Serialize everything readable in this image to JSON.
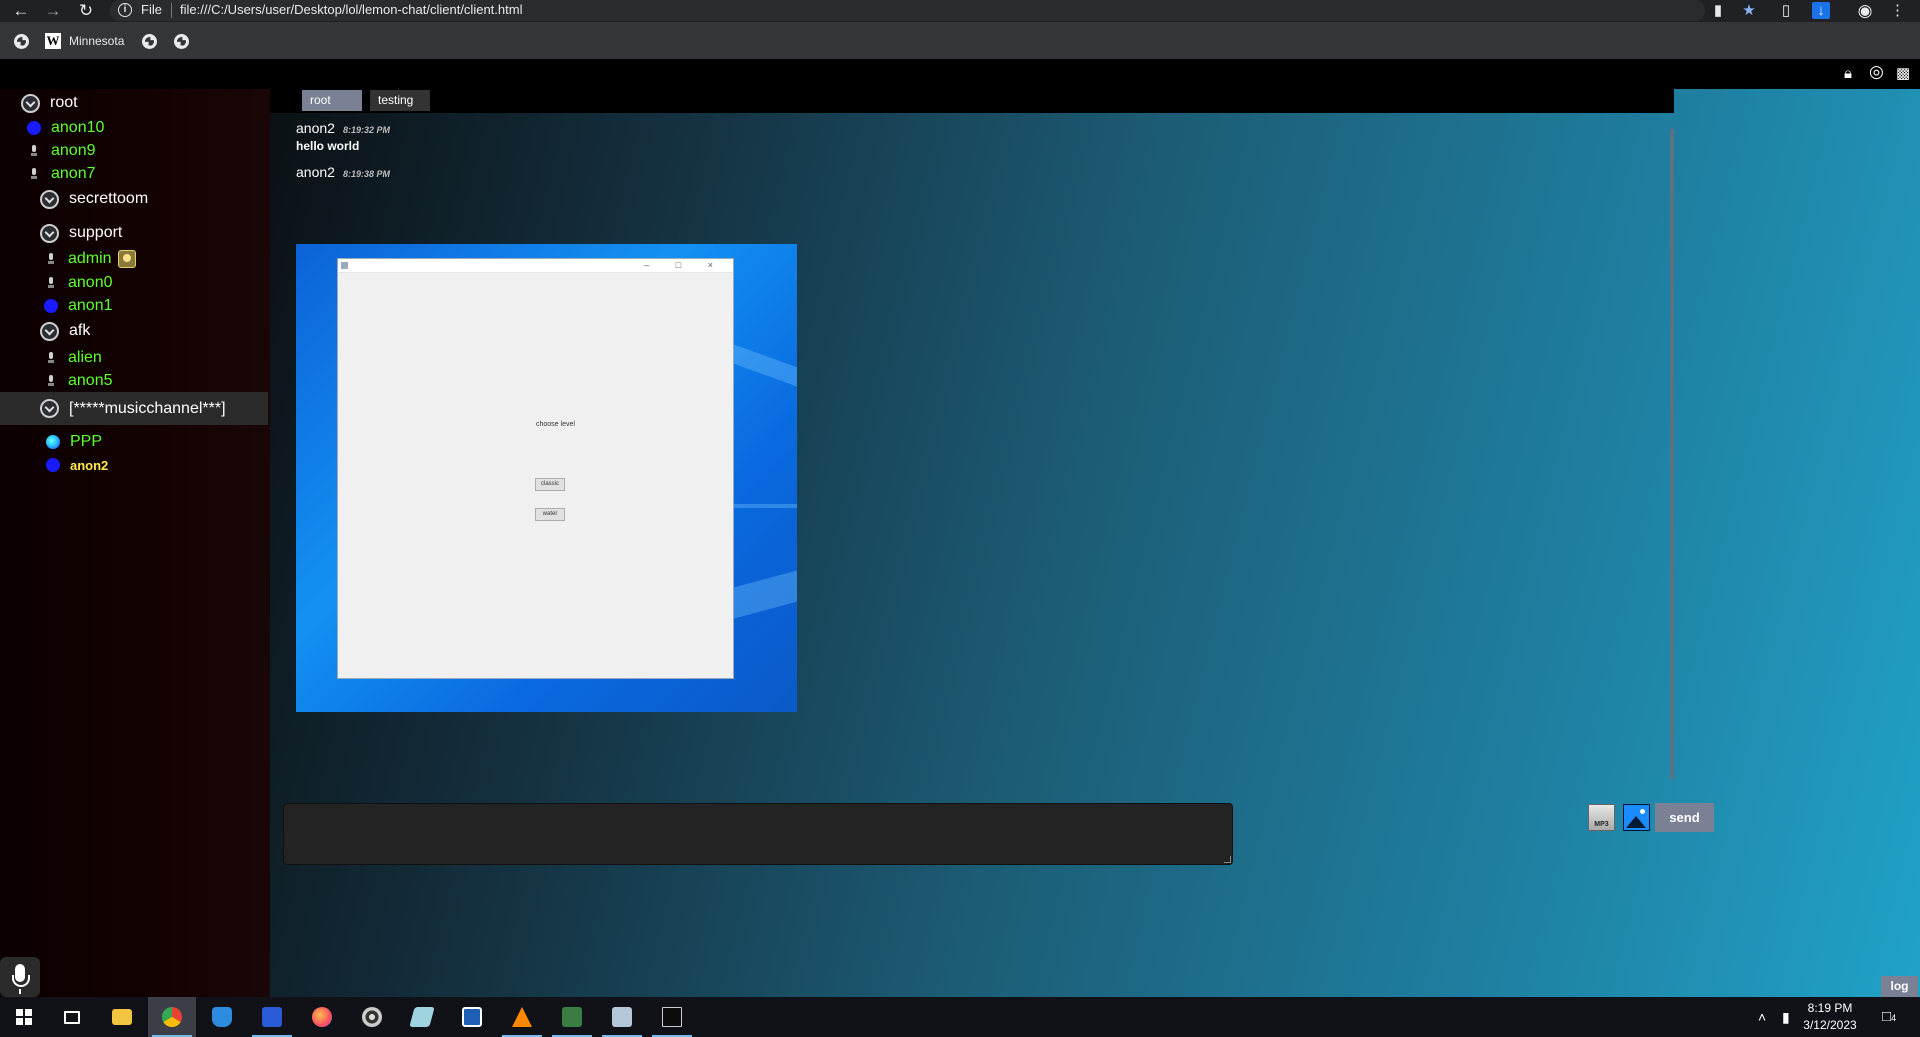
{
  "browser": {
    "scheme": "File",
    "url": "file:///C:/Users/user/Desktop/lol/lemon-chat/client/client.html",
    "bookmarks": [
      {
        "label": ""
      },
      {
        "label": "Minnesota",
        "badge": "W"
      },
      {
        "label": ""
      },
      {
        "label": ""
      }
    ]
  },
  "app": {
    "tabs": [
      {
        "label": "root",
        "active": true
      },
      {
        "label": "testing",
        "active": false
      }
    ],
    "tree": {
      "root": "root",
      "root_users": [
        "anon10",
        "anon9",
        "anon7"
      ],
      "channels": {
        "secrettoom": "secrettoom",
        "support": "support",
        "support_users": [
          "admin",
          "anon0",
          "anon1"
        ],
        "afk": "afk",
        "afk_users": [
          "alien",
          "anon5"
        ],
        "music": "[*****musicchannel***]",
        "music_users": [
          "PPP",
          "anon2"
        ]
      }
    },
    "messages": [
      {
        "author": "anon2",
        "time": "8:19:32 PM",
        "text": "hello world"
      },
      {
        "author": "anon2",
        "time": "8:19:38 PM",
        "image": {
          "label": "choose level",
          "buttons": [
            "classic",
            "water"
          ]
        }
      }
    ],
    "composer": {
      "value": "",
      "send_label": "send",
      "mp3_label": "MP3"
    },
    "log_label": "log"
  },
  "taskbar": {
    "time": "8:19 PM",
    "date": "3/12/2023",
    "notifications": "4"
  },
  "colors": {
    "user_green": "#5dff2e",
    "self_yellow": "#ffe94d",
    "button_gray": "#7a8194",
    "gradient_end": "#20a2c7"
  },
  "icons": [
    "back-icon",
    "forward-icon",
    "reload-icon",
    "info-icon",
    "camera-icon",
    "star-icon",
    "extension-icon",
    "download-icon",
    "profile-icon",
    "menu-icon",
    "lock-icon",
    "eye-icon",
    "trash-icon",
    "channel-icon",
    "mic-icon"
  ]
}
